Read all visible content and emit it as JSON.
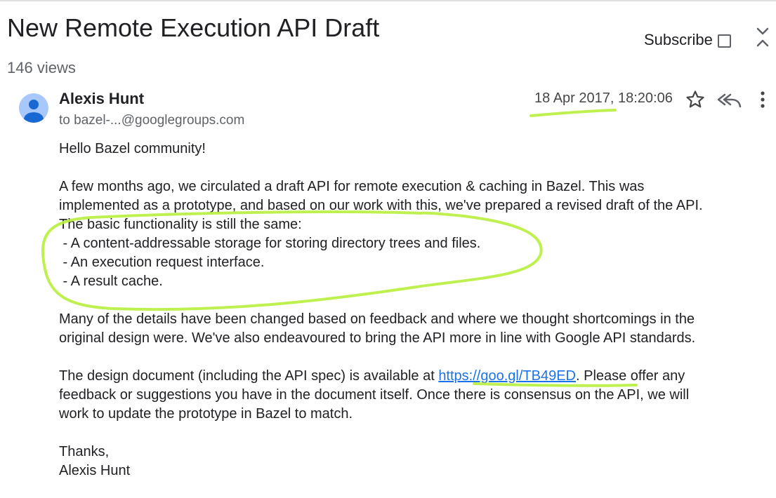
{
  "thread": {
    "title": "New Remote Execution API Draft",
    "views": "146 views",
    "subscribe_label": "Subscribe"
  },
  "icons": {
    "collapse": "collapse-chevrons-icon",
    "star": "star-icon",
    "reply_all": "reply-all-icon",
    "more": "more-vert-icon",
    "avatar": "person-avatar-icon"
  },
  "message": {
    "sender": "Alexis Hunt",
    "recipient": "to bazel-...@googlegroups.com",
    "date": "18 Apr 2017, 18:20:06",
    "greeting": "Hello Bazel community!",
    "para1_line1": "A few months ago, we circulated a draft API for remote execution & caching in Bazel. This was",
    "para1_line2": "implemented as a prototype, and based on our work with this, we've prepared a revised draft of the API.",
    "para1_line3": "The basic functionality is still the same:",
    "bullet1": " - A content-addressable storage for storing directory trees and files.",
    "bullet2": " - An execution request interface.",
    "bullet3": " - A result cache.",
    "para2_line1": "Many of the details have been changed based on feedback and where we thought shortcomings in the",
    "para2_line2": "original design were. We've also endeavoured to bring the API more in line with Google API standards.",
    "para3_pre_link": "The design document (including the API spec) is available at ",
    "link": "https://goo.gl/TB49ED",
    "para3_post_link": ". Please offer any",
    "para3_line2": "feedback or suggestions you have in the document itself. Once there is consensus on the API, we will",
    "para3_line3": "work to update the prototype in Bazel to match.",
    "signoff": "Thanks,",
    "signature": "Alexis Hunt"
  },
  "colors": {
    "highlighter": "#b7f03c",
    "link": "#1a73e8",
    "muted_text": "#5f6368",
    "avatar_bg": "#a8c7fa",
    "avatar_fg": "#1967d2"
  }
}
